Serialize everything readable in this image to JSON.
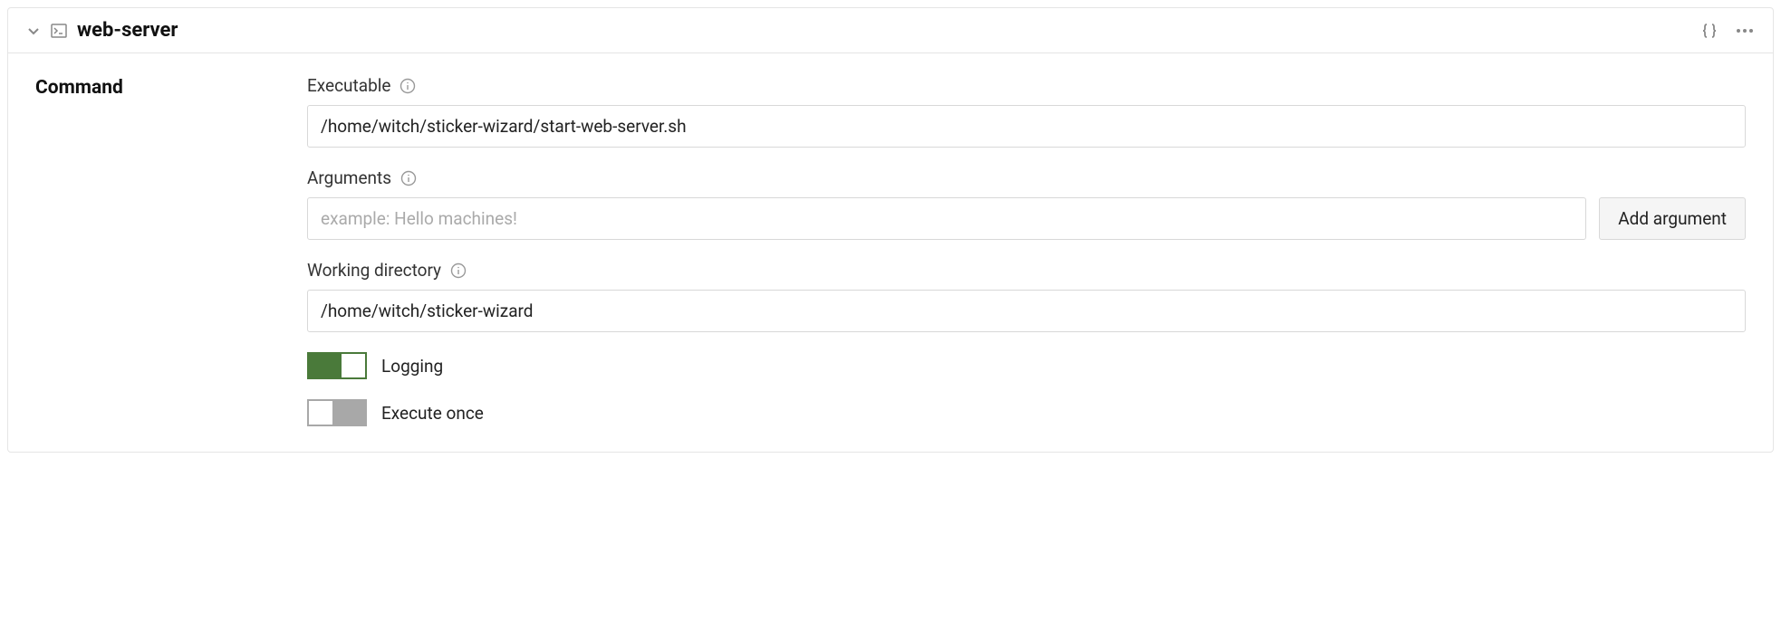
{
  "header": {
    "title": "web-server"
  },
  "section": {
    "label": "Command"
  },
  "fields": {
    "executable": {
      "label": "Executable",
      "value": "/home/witch/sticker-wizard/start-web-server.sh"
    },
    "arguments": {
      "label": "Arguments",
      "placeholder": "example: Hello machines!",
      "value": "",
      "add_button": "Add argument"
    },
    "working_directory": {
      "label": "Working directory",
      "value": "/home/witch/sticker-wizard"
    },
    "logging": {
      "label": "Logging",
      "on": true
    },
    "execute_once": {
      "label": "Execute once",
      "on": false
    }
  }
}
